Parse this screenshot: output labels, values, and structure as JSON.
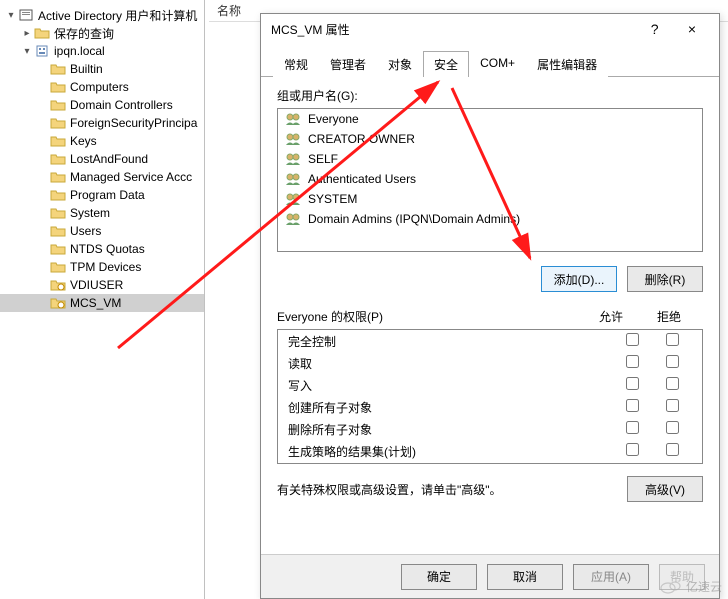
{
  "tree": {
    "root": "Active Directory 用户和计算机",
    "saved_queries": "保存的查询",
    "domain": "ipqn.local",
    "nodes": [
      "Builtin",
      "Computers",
      "Domain Controllers",
      "ForeignSecurityPrincipa",
      "Keys",
      "LostAndFound",
      "Managed Service Accc",
      "Program Data",
      "System",
      "Users",
      "NTDS Quotas",
      "TPM Devices",
      "VDIUSER",
      "MCS_VM"
    ]
  },
  "right_header": "名称",
  "dialog": {
    "title": "MCS_VM 属性",
    "help": "?",
    "close": "×",
    "tabs": [
      "常规",
      "管理者",
      "对象",
      "安全",
      "COM+",
      "属性编辑器"
    ],
    "active_tab": 3,
    "group_label": "组或用户名(G):",
    "principals": [
      "Everyone",
      "CREATOR OWNER",
      "SELF",
      "Authenticated Users",
      "SYSTEM",
      "Domain Admins (IPQN\\Domain Admins)"
    ],
    "btn_add": "添加(D)...",
    "btn_remove": "删除(R)",
    "perm_label": "Everyone 的权限(P)",
    "col_allow": "允许",
    "col_deny": "拒绝",
    "permissions": [
      "完全控制",
      "读取",
      "写入",
      "创建所有子对象",
      "删除所有子对象",
      "生成策略的结果集(计划)"
    ],
    "adv_text": "有关特殊权限或高级设置，请单击\"高级\"。",
    "btn_adv": "高级(V)",
    "btn_ok": "确定",
    "btn_cancel": "取消",
    "btn_apply": "应用(A)",
    "btn_help": "帮助"
  },
  "watermark": "亿速云"
}
